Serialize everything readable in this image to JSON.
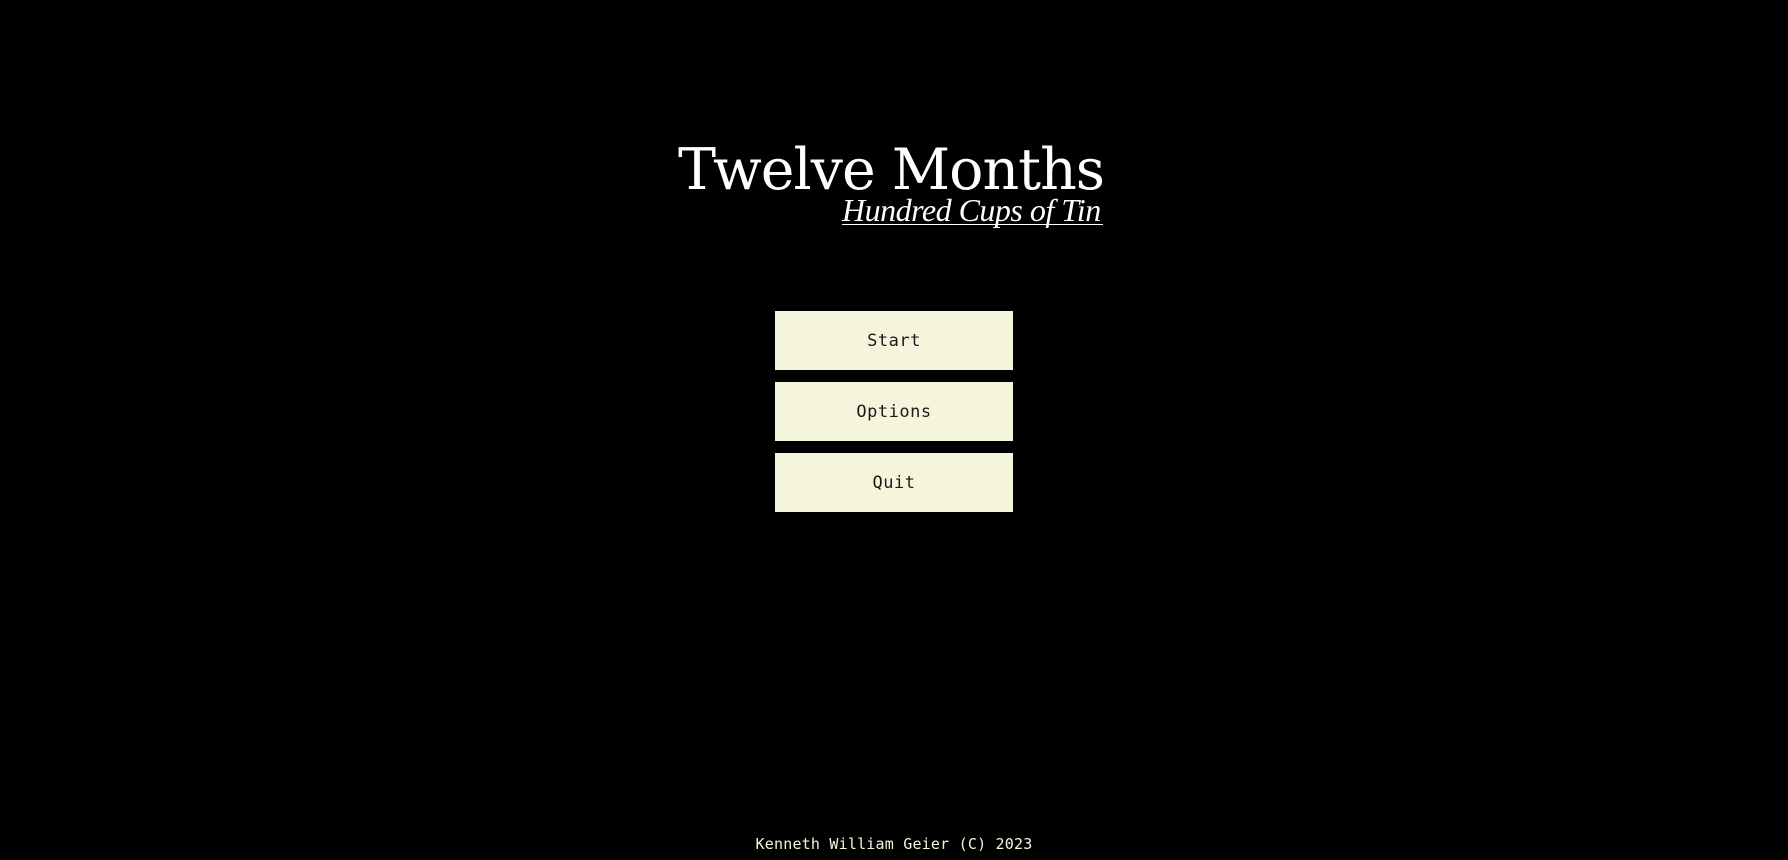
{
  "logo": {
    "title": "Twelve Months",
    "subtitle": "Hundred Cups of Tin"
  },
  "menu": {
    "start_label": "Start",
    "options_label": "Options",
    "quit_label": "Quit"
  },
  "footer": {
    "copyright": "Kenneth William Geier (C) 2023"
  },
  "colors": {
    "background": "#000000",
    "button_background": "#f5f5dc",
    "button_text": "#1a1a1a",
    "logo_text": "#ffffff",
    "footer_text": "#f5f5dc"
  }
}
